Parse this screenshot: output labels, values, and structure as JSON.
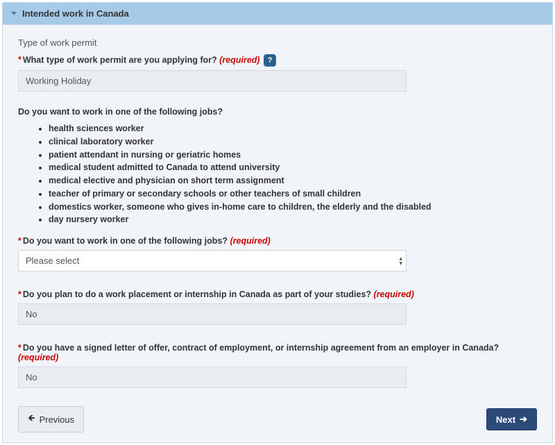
{
  "panel": {
    "title": "Intended work in Canada"
  },
  "section_label": "Type of work permit",
  "required_text": "(required)",
  "q_permit_type": {
    "label": "What type of work permit are you applying for?",
    "value": "Working Holiday"
  },
  "jobs_intro": "Do you want to work in one of the following jobs?",
  "jobs": [
    "health sciences worker",
    "clinical laboratory worker",
    "patient attendant in nursing or geriatric homes",
    "medical student admitted to Canada to attend university",
    "medical elective and physician on short term assignment",
    "teacher of primary or secondary schools or other teachers of small children",
    "domestics worker, someone who gives in-home care to children, the elderly and the disabled",
    "day nursery worker"
  ],
  "q_following_jobs": {
    "label": "Do you want to work in one of the following jobs?",
    "placeholder": "Please select"
  },
  "q_internship": {
    "label": "Do you plan to do a work placement or internship in Canada as part of your studies?",
    "value": "No"
  },
  "q_offer_letter": {
    "label": "Do you have a signed letter of offer, contract of employment, or internship agreement from an employer in Canada?",
    "value": "No"
  },
  "buttons": {
    "previous": "Previous",
    "next": "Next"
  },
  "glyphs": {
    "help": "?",
    "arrow_left": "🡸",
    "arrow_right": "➔",
    "up": "▴",
    "down": "▾"
  }
}
